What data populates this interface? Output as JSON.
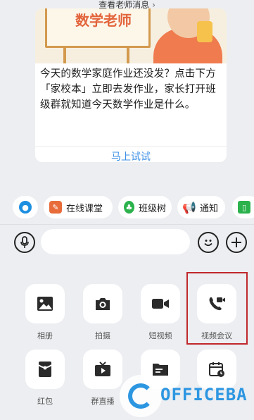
{
  "top_link": {
    "label": "查看老师消息",
    "chevron": "›"
  },
  "card": {
    "board_text": "数学老师",
    "message": "今天的数学家庭作业还没发？点击下方「家校本」立即去发作业，家长打开班级群就知道今天数学作业是什么。",
    "action_label": "马上试试"
  },
  "chips": [
    {
      "label": "",
      "icon": "app-icon",
      "color": "#1d8fe0"
    },
    {
      "label": "在线课堂",
      "icon": "classroom-icon",
      "color": "#e86b3a"
    },
    {
      "label": "班级树",
      "icon": "tree-icon",
      "color": "#2bb24c"
    },
    {
      "label": "通知",
      "icon": "megaphone-icon",
      "color": "#f0883a"
    },
    {
      "label": "",
      "icon": "homework-icon",
      "color": "#2bb24c"
    }
  ],
  "input": {
    "placeholder": ""
  },
  "tools": [
    {
      "label": "相册",
      "icon": "image-icon"
    },
    {
      "label": "拍摄",
      "icon": "camera-icon"
    },
    {
      "label": "短视频",
      "icon": "video-icon"
    },
    {
      "label": "视频会议",
      "icon": "video-call-icon"
    },
    {
      "label": "红包",
      "icon": "red-packet-icon"
    },
    {
      "label": "群直播",
      "icon": "live-tv-icon"
    },
    {
      "label": "",
      "icon": "folder-icon"
    },
    {
      "label": "",
      "icon": "calendar-icon"
    }
  ],
  "watermark": {
    "text": "OFFICEBA"
  },
  "colors": {
    "accent": "#3a8ee6",
    "highlight": "#c0282c",
    "watermark": "#1d8fe0"
  }
}
